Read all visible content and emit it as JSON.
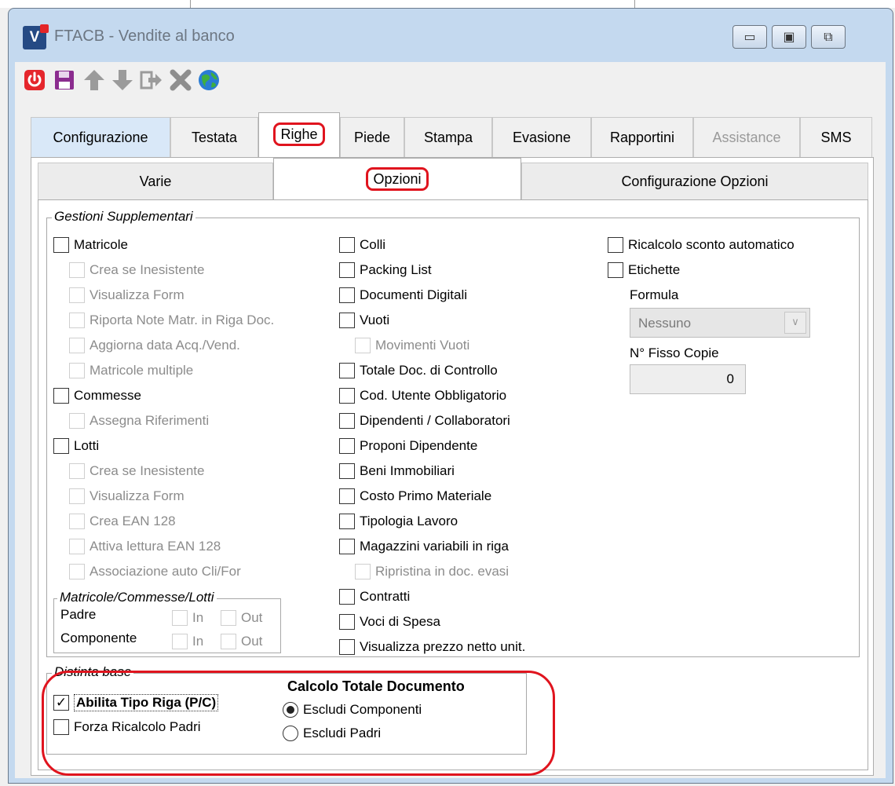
{
  "window": {
    "title": "FTACB - Vendite al banco",
    "logo_letter": "V"
  },
  "window_controls": {
    "minimize": "▭",
    "maximize": "▣",
    "close": "⧉"
  },
  "toolbar": {
    "icons": [
      "power-icon",
      "save-icon",
      "arrow-up-icon",
      "arrow-down-icon",
      "exit-doc-icon",
      "delete-icon",
      "globe-icon"
    ]
  },
  "tabs": [
    "Configurazione",
    "Testata",
    "Righe",
    "Piede",
    "Stampa",
    "Evasione",
    "Rapportini",
    "Assistance",
    "SMS"
  ],
  "active_tab": "Righe",
  "subtabs": [
    "Varie",
    "Opzioni",
    "Configurazione Opzioni"
  ],
  "active_subtab": "Opzioni",
  "gestioni": {
    "legend": "Gestioni Supplementari",
    "col1": [
      {
        "label": "Matricole",
        "checked": false,
        "enabled": true
      },
      {
        "label": "Crea se Inesistente",
        "checked": false,
        "enabled": false
      },
      {
        "label": "Visualizza Form",
        "checked": false,
        "enabled": false
      },
      {
        "label": "Riporta Note Matr. in Riga Doc.",
        "checked": false,
        "enabled": false
      },
      {
        "label": "Aggiorna data Acq./Vend.",
        "checked": false,
        "enabled": false
      },
      {
        "label": "Matricole multiple",
        "checked": false,
        "enabled": false
      },
      {
        "label": "Commesse",
        "checked": false,
        "enabled": true
      },
      {
        "label": "Assegna Riferimenti",
        "checked": false,
        "enabled": false
      },
      {
        "label": "Lotti",
        "checked": false,
        "enabled": true
      },
      {
        "label": "Crea se Inesistente",
        "checked": false,
        "enabled": false
      },
      {
        "label": "Visualizza Form",
        "checked": false,
        "enabled": false
      },
      {
        "label": "Crea EAN 128",
        "checked": false,
        "enabled": false
      },
      {
        "label": "Attiva lettura EAN 128",
        "checked": false,
        "enabled": false
      },
      {
        "label": "Associazione auto Cli/For",
        "checked": false,
        "enabled": false
      }
    ],
    "col2": [
      {
        "label": "Colli",
        "checked": false,
        "enabled": true
      },
      {
        "label": "Packing List",
        "checked": false,
        "enabled": true
      },
      {
        "label": "Documenti Digitali",
        "checked": false,
        "enabled": true
      },
      {
        "label": "Vuoti",
        "checked": false,
        "enabled": true
      },
      {
        "label": "Movimenti Vuoti",
        "checked": false,
        "enabled": false
      },
      {
        "label": "Totale Doc. di Controllo",
        "checked": false,
        "enabled": true
      },
      {
        "label": "Cod. Utente Obbligatorio",
        "checked": false,
        "enabled": true
      },
      {
        "label": "Dipendenti / Collaboratori",
        "checked": false,
        "enabled": true
      },
      {
        "label": "Proponi Dipendente",
        "checked": false,
        "enabled": true
      },
      {
        "label": "Beni Immobiliari",
        "checked": false,
        "enabled": true
      },
      {
        "label": "Costo Primo Materiale",
        "checked": false,
        "enabled": true
      },
      {
        "label": "Tipologia Lavoro",
        "checked": false,
        "enabled": true
      },
      {
        "label": "Magazzini variabili in riga",
        "checked": false,
        "enabled": true
      },
      {
        "label": "Ripristina in doc. evasi",
        "checked": false,
        "enabled": false
      },
      {
        "label": "Contratti",
        "checked": false,
        "enabled": true
      },
      {
        "label": "Voci di Spesa",
        "checked": false,
        "enabled": true
      },
      {
        "label": "Visualizza prezzo netto unit.",
        "checked": false,
        "enabled": true
      }
    ],
    "col3": [
      {
        "label": "Ricalcolo sconto automatico",
        "checked": false,
        "enabled": true
      },
      {
        "label": "Etichette",
        "checked": false,
        "enabled": true
      }
    ],
    "formula_label": "Formula",
    "formula_value": "Nessuno",
    "copie_label": "N° Fisso Copie",
    "copie_value": "0"
  },
  "mcl": {
    "legend": "Matricole/Commesse/Lotti",
    "padre_label": "Padre",
    "componente_label": "Componente",
    "in_label": "In",
    "out_label": "Out"
  },
  "distinta": {
    "legend": "Distinta base",
    "abilita_label": "Abilita Tipo Riga (P/C)",
    "abilita_checked": true,
    "forza_label": "Forza Ricalcolo Padri",
    "forza_checked": false,
    "calcolo_title": "Calcolo Totale Documento",
    "radio_options": [
      "Escludi Componenti",
      "Escludi Padri"
    ],
    "radio_selected": "Escludi Componenti"
  },
  "colors": {
    "accent_highlight": "#e0141e",
    "title_bg": "#c4d9ef",
    "disabled_text": "#8c8c8c"
  }
}
